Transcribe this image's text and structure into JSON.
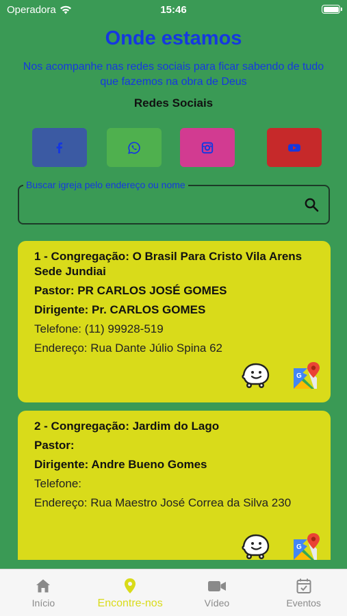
{
  "status_bar": {
    "carrier": "Operadora",
    "time": "15:46"
  },
  "header": {
    "title": "Onde estamos",
    "subtitle": "Nos acompanhe nas redes sociais para ficar sabendo de tudo que fazemos na obra de Deus",
    "social_title": "Redes Sociais"
  },
  "social": [
    {
      "icon": "facebook-icon",
      "color": "#3b5aa3"
    },
    {
      "icon": "whatsapp-icon",
      "color": "#4fb04e"
    },
    {
      "icon": "instagram-icon",
      "color": "#d23b91"
    },
    {
      "icon": "youtube-icon",
      "color": "#c6292a"
    }
  ],
  "search": {
    "label": "Buscar igreja pelo endereço ou nome",
    "value": ""
  },
  "churches": [
    {
      "name": "1 - Congregação: O Brasil Para Cristo Vila Arens Sede Jundiai",
      "pastor": "Pastor: PR CARLOS JOSÉ GOMES",
      "leader": "Dirigente: Pr. CARLOS GOMES",
      "phone": "Telefone: (11) 99928-519",
      "address": "Endereço: Rua Dante Júlio Spina 62"
    },
    {
      "name": "2 - Congregação: Jardim do Lago",
      "pastor": "Pastor:",
      "leader": "Dirigente: Andre Bueno Gomes",
      "phone": "Telefone:",
      "address": "Endereço: Rua Maestro José Correa da Silva 230"
    }
  ],
  "tabs": [
    {
      "label": "Início",
      "icon": "home-icon",
      "active": false
    },
    {
      "label": "Encontre-nos",
      "icon": "location-pin-icon",
      "active": true
    },
    {
      "label": "Vídeo",
      "icon": "video-camera-icon",
      "active": false
    },
    {
      "label": "Eventos",
      "icon": "calendar-icon",
      "active": false
    }
  ],
  "colors": {
    "background": "#3a9a55",
    "accent": "#d9db1a",
    "title": "#1538e0"
  }
}
